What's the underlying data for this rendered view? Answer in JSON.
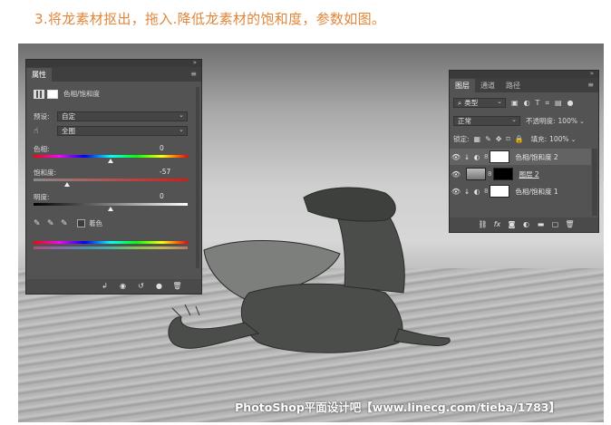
{
  "heading": "3.将龙素材抠出，拖入.降低龙素材的饱和度，参数如图。",
  "watermark": "PhotoShop平面设计吧【www.linecg.com/tieba/1783】",
  "properties": {
    "tab": "属性",
    "title": "色相/饱和度",
    "preset_label": "预设:",
    "preset_value": "自定",
    "range_value": "全图",
    "hue_label": "色相:",
    "hue_value": "0",
    "sat_label": "饱和度:",
    "sat_value": "-57",
    "light_label": "明度:",
    "light_value": "0",
    "colorize_label": "着色"
  },
  "sliders": {
    "hue": 0,
    "saturation": -57,
    "lightness": 0,
    "min": -100,
    "max": 100
  },
  "layers": {
    "tabs": [
      "图层",
      "通道",
      "路径"
    ],
    "kind": "类型",
    "blend": "正常",
    "opacity_label": "不透明度:",
    "opacity": "100%",
    "lock_label": "锁定:",
    "fill_label": "填充:",
    "fill": "100%",
    "items": [
      {
        "name": "色相/饱和度 2",
        "visible": true,
        "selected": true,
        "type": "adjustment",
        "mask": "white"
      },
      {
        "name": "图层 2",
        "visible": true,
        "selected": false,
        "type": "pixel",
        "mask": "black"
      },
      {
        "name": "色相/饱和度 1",
        "visible": true,
        "selected": false,
        "type": "adjustment",
        "mask": "white"
      }
    ]
  },
  "colors": {
    "accent_heading": "#e0863a",
    "panel_bg": "#535353",
    "selected_row": "#636363"
  }
}
